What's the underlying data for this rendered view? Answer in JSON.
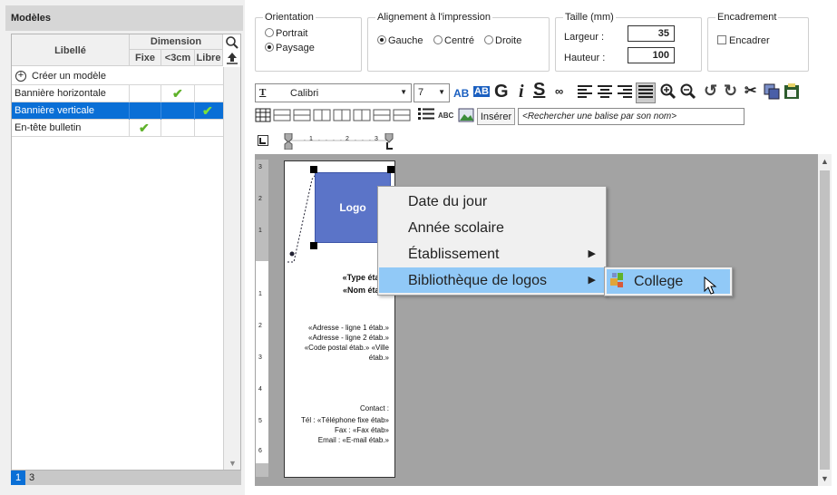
{
  "panel": {
    "title": "Modèles",
    "col_libelle": "Libellé",
    "col_dimension": "Dimension",
    "col_fixe": "Fixe",
    "col_lt3cm": "<3cm",
    "col_libre": "Libre",
    "create_label": "Créer un modèle",
    "rows": [
      {
        "label": "Bannière horizontale",
        "fixe": false,
        "lt3cm": true,
        "libre": false,
        "selected": false
      },
      {
        "label": "Bannière verticale",
        "fixe": false,
        "lt3cm": false,
        "libre": true,
        "selected": true
      },
      {
        "label": "En-tête bulletin",
        "fixe": true,
        "lt3cm": false,
        "libre": false,
        "selected": false
      }
    ],
    "pager": {
      "current": "1",
      "next": "3"
    }
  },
  "orientation": {
    "title": "Orientation",
    "portrait": "Portrait",
    "paysage": "Paysage",
    "selected": "Paysage"
  },
  "alignment": {
    "title": "Alignement à l'impression",
    "gauche": "Gauche",
    "centre": "Centré",
    "droite": "Droite",
    "selected": "Gauche"
  },
  "size": {
    "title": "Taille (mm)",
    "largeur_label": "Largeur :",
    "largeur": "35",
    "hauteur_label": "Hauteur :",
    "hauteur": "100"
  },
  "frame": {
    "title": "Encadrement",
    "label": "Encadrer",
    "checked": false
  },
  "toolbar": {
    "font": "Calibri",
    "font_size": "7",
    "insert_label": "Insérer",
    "search_placeholder": "<Rechercher une balise par son nom>"
  },
  "doc": {
    "logo": "Logo",
    "type_etab": "«Type étab»",
    "nom_etab": "«Nom étab»",
    "addr1": "«Adresse - ligne 1 étab.»",
    "addr2": "«Adresse - ligne 2 étab.»",
    "cp": "«Code postal étab.» «Ville",
    "ville": "étab.»",
    "contact": "Contact :",
    "tel": "Tél :  «Téléphone fixe étab»",
    "fax": "Fax :  «Fax étab»",
    "email": "Email : «E-mail étab.»"
  },
  "menu": {
    "items": [
      "Date du jour",
      "Année scolaire",
      "Établissement",
      "Bibliothèque de logos"
    ],
    "sub_item": "College"
  },
  "ruler_v": [
    "3",
    "2",
    "1",
    "1",
    "2",
    "3",
    "4",
    "5",
    "6"
  ],
  "ruler_h": [
    "1",
    "2",
    "3"
  ],
  "colors": {
    "selection": "#0a6fd6",
    "menu_highlight": "#91c9f7",
    "logo_fill": "#5b74c8",
    "check": "#5fb22a",
    "canvas": "#a3a3a3"
  }
}
